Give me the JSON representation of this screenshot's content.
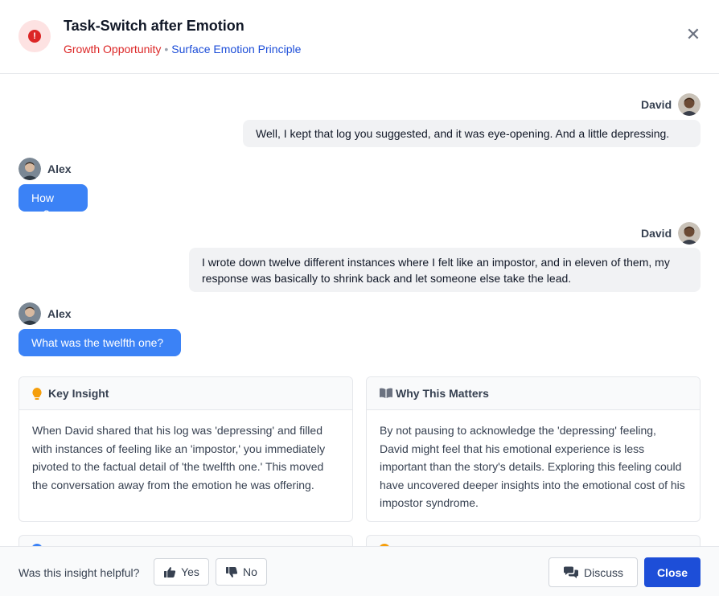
{
  "header": {
    "title": "Task-Switch after Emotion",
    "category": "Growth Opportunity",
    "separator": "•",
    "principle": "Surface Emotion Principle",
    "alert_icon": "exclamation-circle-icon",
    "close_icon": "close-icon",
    "close_symbol": "✕"
  },
  "chat": {
    "messages": [
      {
        "speaker": "David",
        "side": "right",
        "text": "Well, I kept that log you suggested, and it was eye-opening. And a little depressing."
      },
      {
        "speaker": "Alex",
        "side": "left",
        "text": "How so?"
      },
      {
        "speaker": "David",
        "side": "right",
        "text": "I wrote down twelve different instances where I felt like an impostor, and in eleven of them, my response was basically to shrink back and let someone else take the lead."
      },
      {
        "speaker": "Alex",
        "side": "left",
        "text": "What was the twelfth one?"
      }
    ]
  },
  "cards": [
    {
      "icon": "lightbulb-icon",
      "title": "Key Insight",
      "body": "When David shared that his log was 'depressing' and filled with instances of feeling like an 'impostor,' you immediately pivoted to the factual detail of 'the twelfth one.' This moved the conversation away from the emotion he was offering."
    },
    {
      "icon": "book-open-icon",
      "title": "Why This Matters",
      "body": "By not pausing to acknowledge the 'depressing' feeling, David might feel that his emotional experience is less important than the story's details. Exploring this feeling could have uncovered deeper insights into the emotional cost of his impostor syndrome."
    }
  ],
  "footer": {
    "question": "Was this insight helpful?",
    "yes_label": "Yes",
    "no_label": "No",
    "discuss_label": "Discuss",
    "close_label": "Close"
  },
  "colors": {
    "accent": "#3b82f6",
    "primary_button": "#1d4ed8",
    "alert": "#dc2626",
    "category_text": "#dc2626",
    "principle_text": "#1d4ed8"
  }
}
